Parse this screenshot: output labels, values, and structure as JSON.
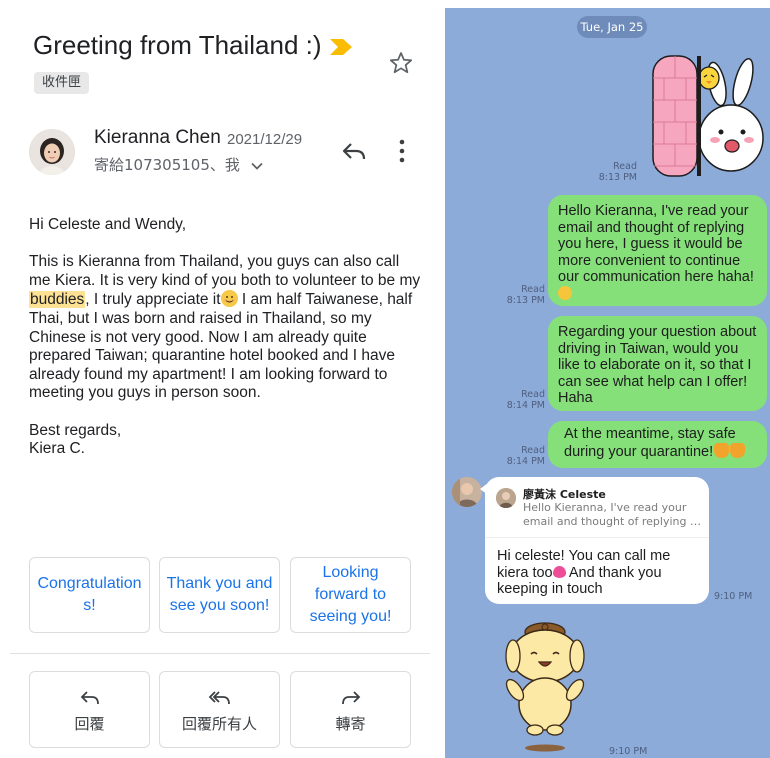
{
  "gmail": {
    "subject": "Greeting from Thailand :)",
    "label_chip": "收件匣",
    "sender_name": "Kieranna Chen",
    "sender_date": "2021/12/29",
    "recipients": "寄給107305105、我",
    "body": {
      "greeting": "Hi Celeste and Wendy,",
      "p1_a": "This is Kieranna from Thailand, you guys can also call me Kiera. It is very kind of you both to volunteer to be my ",
      "p1_highlight": "buddies",
      "p1_b": ", I truly appreciate it",
      "p1_c": " I am half Taiwanese, half Thai, but I was born and raised in Thailand, so my Chinese is not very good. Now I am already quite prepared Taiwan; quarantine hotel booked and I have already found my apartment! I am looking forward to meeting you guys in person soon.",
      "sign1": "Best regards,",
      "sign2": "Kiera C."
    },
    "smart_replies": [
      "Congratulations!",
      "Thank you and see you soon!",
      "Looking forward to seeing you!"
    ],
    "actions": {
      "reply": "回覆",
      "reply_all": "回覆所有人",
      "forward": "轉寄"
    },
    "icons": [
      "importance-marker-icon",
      "star-icon",
      "reply-icon",
      "more-vert-icon",
      "reply-all-icon",
      "forward-icon"
    ],
    "colors": {
      "link_blue": "#1a73e8",
      "highlight": "#fde293",
      "importance": "#fbbc04"
    }
  },
  "line_chat": {
    "date_pill": "Tue, Jan 25",
    "messages": [
      {
        "read": "Read",
        "time": "8:13 PM"
      },
      {
        "read": "Read",
        "time": "8:13 PM",
        "text": "Hello Kieranna, I've read your email and thought of replying you here, I guess it would be more convenient to continue our communication here haha!"
      },
      {
        "read": "Read",
        "time": "8:14 PM",
        "text": "Regarding your question about driving in Taiwan, would you like to elaborate on it, so that I can see what help can I offer! Haha"
      },
      {
        "read": "Read",
        "time": "8:14 PM",
        "text": "At the meantime, stay safe during your quarantine!"
      }
    ],
    "reply": {
      "quote_name": "廖黃沫 Celeste",
      "quote_line1": "Hello Kieranna, I've read your",
      "quote_line2": "email and thought of replying y...",
      "text_a": "Hi celeste! You can call me kiera too",
      "text_b": " And thank you keeping in touch",
      "time": "9:10 PM"
    },
    "last_time": "9:10 PM",
    "colors": {
      "background": "#8cabd9",
      "bubble_green": "#85e07a",
      "bubble_white": "#ffffff"
    }
  }
}
